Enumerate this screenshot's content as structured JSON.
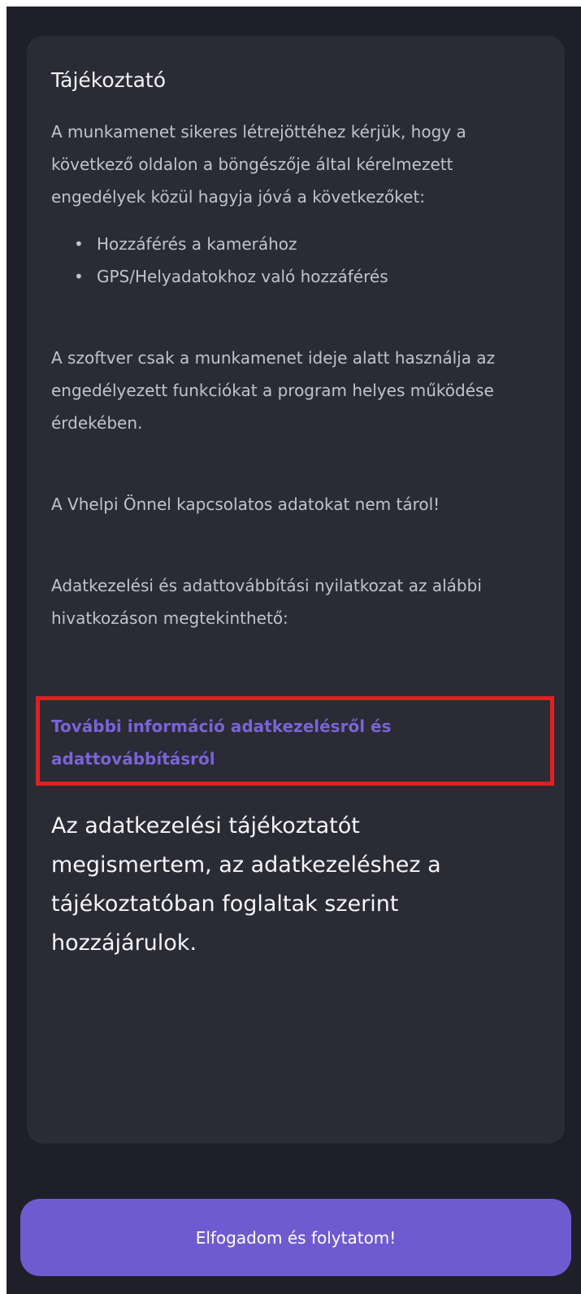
{
  "card": {
    "title": "Tájékoztató",
    "intro": "A munkamenet sikeres létrejöttéhez kérjük, hogy a következő oldalon a böngészője által kérelmezett engedélyek közül hagyja jóvá a következőket:",
    "permissions": [
      "Hozzáférés a kamerához",
      "GPS/Helyadatokhoz való hozzáférés"
    ],
    "usage_note": "A szoftver csak a munkamenet ideje alatt használja az engedélyezett funkciókat a program helyes működése érdekében.",
    "storage_note": "A Vhelpi Önnel kapcsolatos adatokat nem tárol!",
    "statement_note": "Adatkezelési és adattovábbítási nyilatkozat az alábbi hivatkozáson megtekinthető:",
    "more_info_link": "További információ adatkezelésről és adattovábbításról",
    "consent": "Az adatkezelési tájékoztatót megismertem, az adatkezeléshez a tájékoztatóban foglaltak szerint hozzájárulok."
  },
  "footer": {
    "accept_button": "Elfogadom és folytatom!"
  },
  "colors": {
    "background": "#1f1f29",
    "card": "#2a2b35",
    "accent": "#6f5bd0",
    "link": "#7b63d6",
    "highlight": "#e02020"
  }
}
